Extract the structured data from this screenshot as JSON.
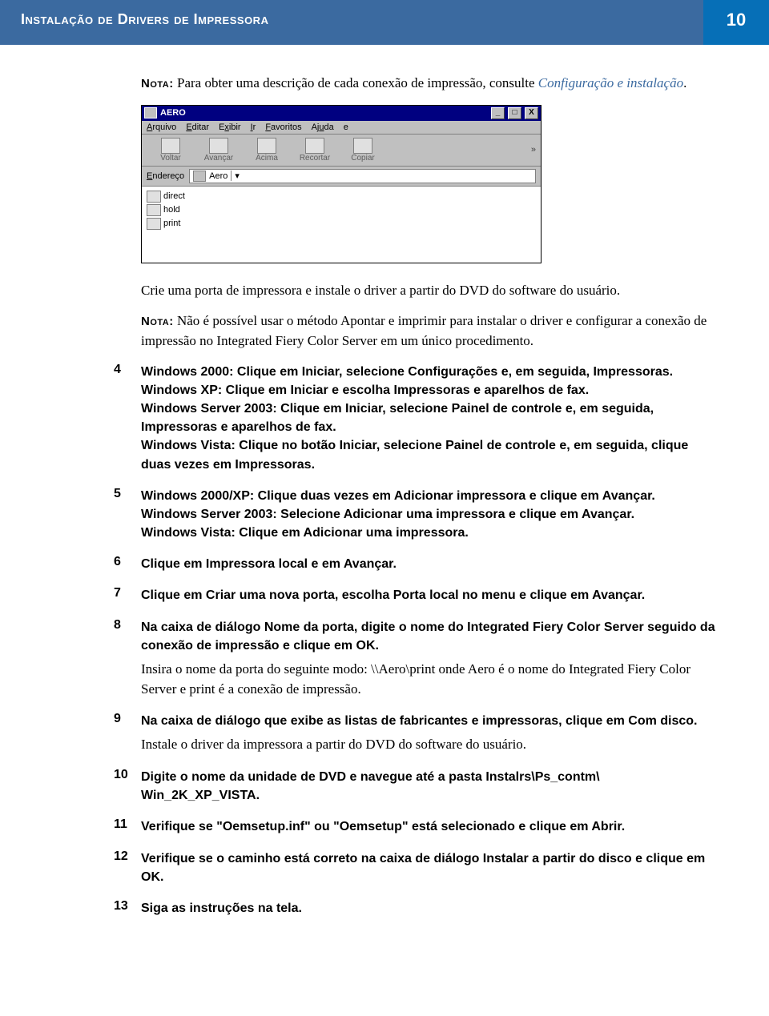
{
  "header": {
    "title": "Instalação de Drivers de Impressora",
    "page_number": "10"
  },
  "intro_nota": {
    "label": "Nota:",
    "text_before": " Para obter uma descrição de cada conexão de impressão, consulte ",
    "ref": "Configuração e instalação",
    "text_after": "."
  },
  "win": {
    "title": "AERO",
    "menu": {
      "arquivo": "Arquivo",
      "editar": "Editar",
      "exibir": "Exibir",
      "ir": "Ir",
      "favoritos": "Favoritos",
      "ajuda": "Ajuda"
    },
    "toolbar": {
      "voltar": "Voltar",
      "avancar": "Avançar",
      "acima": "Acima",
      "recortar": "Recortar",
      "copiar": "Copiar"
    },
    "addr_label": "Endereço",
    "addr_value": "Aero",
    "files": [
      "direct",
      "hold",
      "print"
    ]
  },
  "after_image": "Crie uma porta de impressora e instale o driver a partir do DVD do software do usuário.",
  "nota2": {
    "label": "Nota:",
    "text": " Não é possível usar o método Apontar e imprimir para instalar o driver e configurar a conexão de impressão no Integrated Fiery Color Server em um único procedimento."
  },
  "steps": [
    {
      "bold": "Windows 2000: Clique em Iniciar, selecione Configurações e, em seguida, Impressoras.\nWindows XP: Clique em Iniciar e escolha Impressoras e aparelhos de fax.\nWindows Server 2003: Clique em Iniciar, selecione Painel de controle e, em seguida, Impressoras e aparelhos de fax.\nWindows Vista: Clique no botão Iniciar, selecione Painel de controle e, em seguida, clique duas vezes em Impressoras."
    },
    {
      "bold": "Windows 2000/XP: Clique duas vezes em Adicionar impressora e clique em Avançar.\nWindows Server 2003: Selecione Adicionar uma impressora e clique em Avançar.\nWindows Vista: Clique em Adicionar uma impressora."
    },
    {
      "bold": "Clique em Impressora local e em Avançar."
    },
    {
      "bold": "Clique em Criar uma nova porta, escolha Porta local no menu e clique em Avançar."
    },
    {
      "bold": "Na caixa de diálogo Nome da porta, digite o nome do Integrated Fiery Color Server seguido da conexão de impressão e clique em OK.",
      "plain": "Insira o nome da porta do seguinte modo: \\\\Aero\\print onde Aero é o nome do Integrated Fiery Color Server e print é a conexão de impressão."
    },
    {
      "bold": "Na caixa de diálogo que exibe as listas de fabricantes e impressoras, clique em Com disco.",
      "plain": "Instale o driver da impressora a partir do DVD do software do usuário."
    },
    {
      "bold": "Digite o nome da unidade de DVD e navegue até a pasta Instalrs\\Ps_contm\\ Win_2K_XP_VISTA."
    },
    {
      "bold": "Verifique se \"Oemsetup.inf\" ou \"Oemsetup\" está selecionado e clique em Abrir."
    },
    {
      "bold": "Verifique se o caminho está correto na caixa de diálogo Instalar a partir do disco e clique em OK."
    },
    {
      "bold": "Siga as instruções na tela."
    }
  ]
}
